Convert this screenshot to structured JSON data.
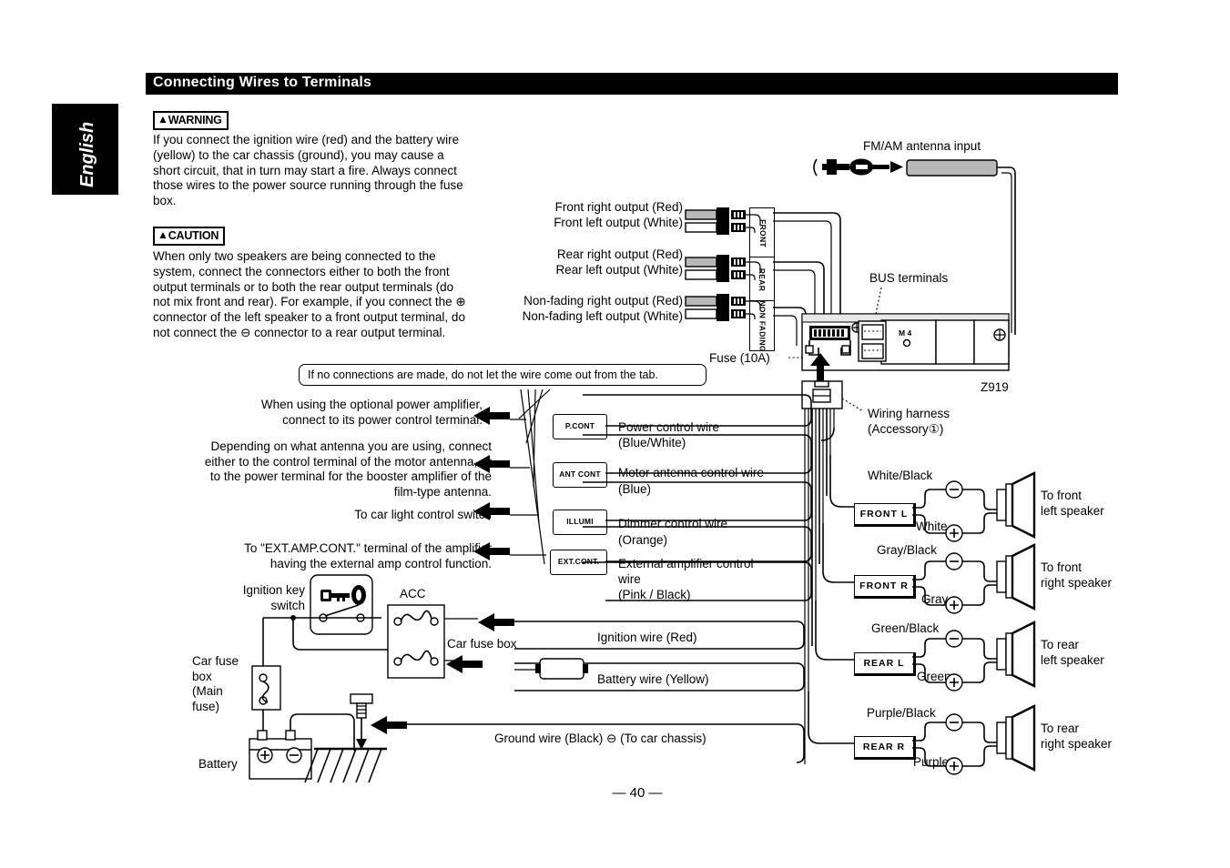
{
  "header": {
    "title": "Connecting Wires to Terminals"
  },
  "side_tab": {
    "label": "English"
  },
  "warning": {
    "badge": "WARNING",
    "text": "If you connect the ignition wire (red) and the battery wire (yellow) to the car chassis (ground), you may cause a short circuit, that in turn may start a fire. Always connect those wires to the power source running through the fuse box."
  },
  "caution": {
    "badge": "CAUTION",
    "text_1": "When only two speakers are being connected to the system, connect the connectors either to both the front output terminals or to both the rear output terminals (do not mix front and rear). For example, if you connect the ",
    "plus": "⊕",
    "text_2": " connector of the left speaker to a front output terminal, do not connect the ",
    "minus": "⊖",
    "text_3": " connector to a rear output terminal."
  },
  "rca_outputs": [
    {
      "line1": "Front right output (Red)",
      "line2": "Front left output (White)"
    },
    {
      "line1": "Rear right output (Red)",
      "line2": "Rear left output (White)"
    },
    {
      "line1": "Non-fading right output (Red)",
      "line2": "Non-fading left output (White)"
    }
  ],
  "unit": {
    "antenna_label": "FM/AM antenna input",
    "bus_label": "BUS terminals",
    "model": "Z919",
    "screw_mark": "M 4",
    "fuse_label": "Fuse (10A)",
    "harness_label_1": "Wiring harness",
    "harness_label_2": "(Accessory①)",
    "vconn": [
      {
        "label": "FRONT"
      },
      {
        "label": "REAR"
      },
      {
        "label": "NON\nFADING"
      }
    ]
  },
  "note_box": {
    "text": "If no connections are made, do not let the wire come out from the tab."
  },
  "control_callouts": [
    {
      "text": "When using the optional power amplifier,\nconnect to its power control terminal."
    },
    {
      "text": "Depending on what antenna you are using, connect\neither to the control terminal of the motor antenna, or\nto the power terminal for the booster amplifier of the\nfilm-type antenna."
    },
    {
      "text": "To car light control switch"
    },
    {
      "text": "To \"EXT.AMP.CONT.\" terminal of the amplifier\nhaving the external amp control function."
    }
  ],
  "control_wires": [
    {
      "tab": "P.CONT",
      "name": "Power control wire",
      "color": "(Blue/White)"
    },
    {
      "tab": "ANT\nCONT",
      "name": "Motor antenna control wire",
      "color": "(Blue)"
    },
    {
      "tab": "ILLUMI",
      "name": "Dimmer control wire",
      "color": "(Orange)"
    },
    {
      "tab": "EXT.CONT.",
      "name": "External amplifier control\nwire",
      "color": "(Pink / Black)"
    }
  ],
  "power_wires": {
    "ignition": "Ignition wire (Red)",
    "battery": "Battery wire (Yellow)",
    "ground_1": "Ground wire (Black) ",
    "ground_minus": "⊖",
    "ground_2": " (To car chassis)"
  },
  "car_parts": {
    "ignition_key": "Ignition key\nswitch",
    "acc": "ACC",
    "car_fuse_box": "Car fuse box",
    "main_fuse": "Car fuse\nbox\n(Main\nfuse)",
    "battery": "Battery",
    "battery_plus": "⊕",
    "battery_minus": "⊖"
  },
  "speakers": [
    {
      "box": "FRONT  L",
      "neg": "White/Black",
      "pos": "White",
      "dest": "To front\nleft speaker"
    },
    {
      "box": "FRONT  R",
      "neg": "Gray/Black",
      "pos": "Gray",
      "dest": "To front\nright speaker"
    },
    {
      "box": "REAR  L",
      "neg": "Green/Black",
      "pos": "Green",
      "dest": "To rear\nleft speaker"
    },
    {
      "box": "REAR  R",
      "neg": "Purple/Black",
      "pos": "Purple",
      "dest": "To rear\nright speaker"
    }
  ],
  "footer": {
    "page": "— 40 —"
  }
}
